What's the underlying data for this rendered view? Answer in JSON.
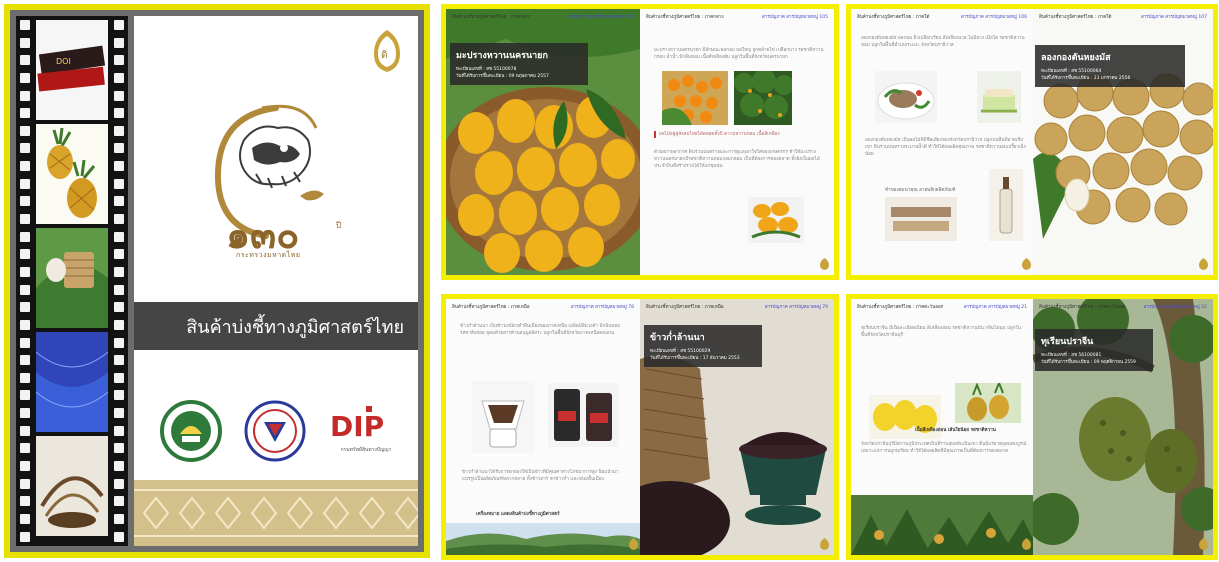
{
  "cover": {
    "anniversary_word": "ปี",
    "ministry": "กระทรวงมหาดไทย",
    "banner_title": "สินค้าบ่งชี้ทางภูมิศาสตร์ไทย",
    "dip_logo_text": "DIP",
    "dip_subtitle": "กรมทรัพย์สินทางปัญญา",
    "film_frames": [
      "brand-packaging",
      "pineapples",
      "sticky-rice-basket",
      "blue-silk",
      "woven-basketry"
    ]
  },
  "spreads": [
    {
      "left_header": "สินค้าบ่งชี้ทางภูมิศาสตร์ไทย : ภาคกลาง",
      "left_header_meta": "สารบัญภาค  สารบัญหมวดหมู่ 104",
      "right_header": "สินค้าบ่งชี้ทางภูมิศาสตร์ไทย : ภาคกลาง",
      "right_header_meta": "สารบัญภาค  สารบัญหมวดหมู่ 105",
      "product_name": "มะปรางหวานนครนายก",
      "reg_no": "ทะเบียนเลขที่ : สช 55100078",
      "reg_date": "วันที่ได้รับการขึ้นทะเบียน : 09 พฤษภาคม 2557",
      "intro_text": "มะปรางหวานนครนายก มีลักษณะผลกลม ผลใหญ่ ลูกคล้ายไข่ เปลือกบาง รสชาติหวานกรอบ ฉ่ำน้ำ มีกลิ่นหอม เนื้อสีเหลืองส้ม ปลูกในพื้นที่จังหวัดนครนายก",
      "section_heading": "ผลไม้อยู่คู่สังคมไทยได้ตลอดทั้งปี ความหวานหอม เนื้อสีเหลือง",
      "body_text": "ด้วยสภาพอากาศ ดินร่วนปนทรายและการดูแลเอาใจใส่ของเกษตรกร ทำให้มะปรางหวานนครนายกมีรสชาติหวานหอมกลมกล่อม เป็นที่ต้องการของตลาด ทั้งยังเป็นผลไม้ประจำถิ่นที่สร้างรายได้ให้แก่ชุมชน"
    },
    {
      "left_header": "สินค้าบ่งชี้ทางภูมิศาสตร์ไทย : ภาคใต้",
      "left_header_meta": "สารบัญภาค  สารบัญหมวดหมู่ 106",
      "right_header": "สินค้าบ่งชี้ทางภูมิศาสตร์ไทย : ภาคใต้",
      "right_header_meta": "สารบัญภาค  สารบัญหมวดหมู่ 107",
      "product_name": "ลองกองตันหยงมัส",
      "reg_no": "ทะเบียนเลขที่ : สช 55100064",
      "reg_date": "วันที่ได้รับการขึ้นทะเบียน : 23 มกราคม 2556",
      "intro_text": "ลองกองตันหยงมัส ผลกลม ผิวเปลือกเรียบ สีเหลืองนวล ไม่มียาง เนื้อใส รสชาติหวานหอม ปลูกในพื้นที่อำเภอระแงะ จังหวัดนราธิวาส",
      "section_heading": "ทำของสมนาคุณ ลายพลิกผลิตภัณฑ์",
      "body_text": "ลองกองตันหยงมัส เป็นผลไม้ที่มีชื่อเสียงของจังหวัดนราธิวาส ปลูกบนพื้นที่ลาดเชิงเขา ดินร่วนปนทรายระบายน้ำดี ทำให้ได้ผลผลิตคุณภาพ รสชาติหวานอมเปรี้ยวเล็กน้อย"
    },
    {
      "left_header": "สินค้าบ่งชี้ทางภูมิศาสตร์ไทย : ภาคเหนือ",
      "left_header_meta": "สารบัญภาค  สารบัญหมวดหมู่ 78",
      "right_header": "สินค้าบ่งชี้ทางภูมิศาสตร์ไทย : ภาคเหนือ",
      "right_header_meta": "สารบัญภาค  สารบัญหมวดหมู่ 79",
      "product_name": "ข้าวก่ำล้านนา",
      "reg_no": "ทะเบียนเลขที่ : สช 55100029",
      "reg_date": "วันที่ได้รับการขึ้นทะเบียน : 17 ธันวาคม 2553",
      "intro_text": "ข้าวก่ำล้านนา เป็นข้าวเหนียวดำพื้นเมืองของภาคเหนือ เมล็ดมีสีม่วงดำ มีกลิ่นหอม รสชาติอร่อย อุดมด้วยสารต้านอนุมูลอิสระ ปลูกในพื้นที่จังหวัดภาคเหนือตอนบน",
      "section_heading": "เครื่องหมาย แสดงสินค้าบ่งชี้ทางภูมิศาสตร์",
      "body_text": "ข้าวก่ำล้านนาได้รับการยกย่องให้เป็นข้าวที่มีคุณค่าทางโภชนาการสูง นิยมนำมาแปรรูปเป็นผลิตภัณฑ์หลากหลาย ทั้งข้าวสาร ชาข้าวก่ำ และขนมพื้นเมือง"
    },
    {
      "left_header": "สินค้าบ่งชี้ทางภูมิศาสตร์ไทย : ภาคตะวันออก",
      "left_header_meta": "สารบัญภาค  สารบัญหมวดหมู่ 21",
      "right_header": "สินค้าบ่งชี้ทางภูมิศาสตร์ไทย : ภาคตะวันออก",
      "right_header_meta": "สารบัญภาค  สารบัญหมวดหมู่ 22",
      "product_name": "ทุเรียนปราจีน",
      "reg_no": "ทะเบียนเลขที่ : สช 56100081",
      "reg_date": "วันที่ได้รับการขึ้นทะเบียน : 09 พฤศจิกายน 2559",
      "intro_text": "ทุเรียนปราจีน มีเนื้อละเอียดเนียน สีเหลืองอ่อน รสชาติหวานมัน กลิ่นไม่ฉุน ปลูกในพื้นที่จังหวัดปราจีนบุรี",
      "section_heading": "เนื้อสีเหลืองอ่อน เส้นใยน้อย รสชาติหวาน",
      "body_text": "จังหวัดปราจีนบุรีมีสภาพภูมิประเทศเป็นที่ราบลุ่มสลับเนินเขา ดินมีแร่ธาตุอุดมสมบูรณ์ เหมาะแก่การปลูกทุเรียน ทำให้ได้ผลผลิตที่มีคุณภาพเป็นที่ต้องการของตลาด"
    }
  ]
}
